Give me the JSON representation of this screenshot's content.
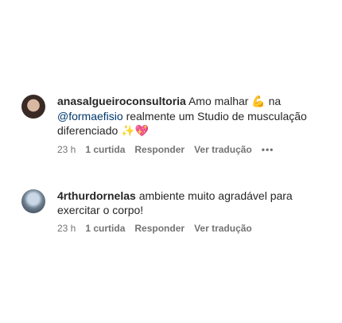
{
  "comments": [
    {
      "username": "anasalgueiroconsultoria",
      "text_before": "Amo malhar ",
      "emoji_muscle": "💪",
      "text_mid": " na ",
      "mention": "@formaefisio",
      "text_after": " realmente um Studio de musculação diferenciado ",
      "emoji_end": "✨💖",
      "time": "23 h",
      "likes": "1 curtida",
      "reply": "Responder",
      "translate": "Ver tradução",
      "more": "•••"
    },
    {
      "username": "4rthurdornelas",
      "text": "ambiente muito agradável para exercitar o corpo!",
      "time": "23 h",
      "likes": "1 curtida",
      "reply": "Responder",
      "translate": "Ver tradução"
    }
  ]
}
